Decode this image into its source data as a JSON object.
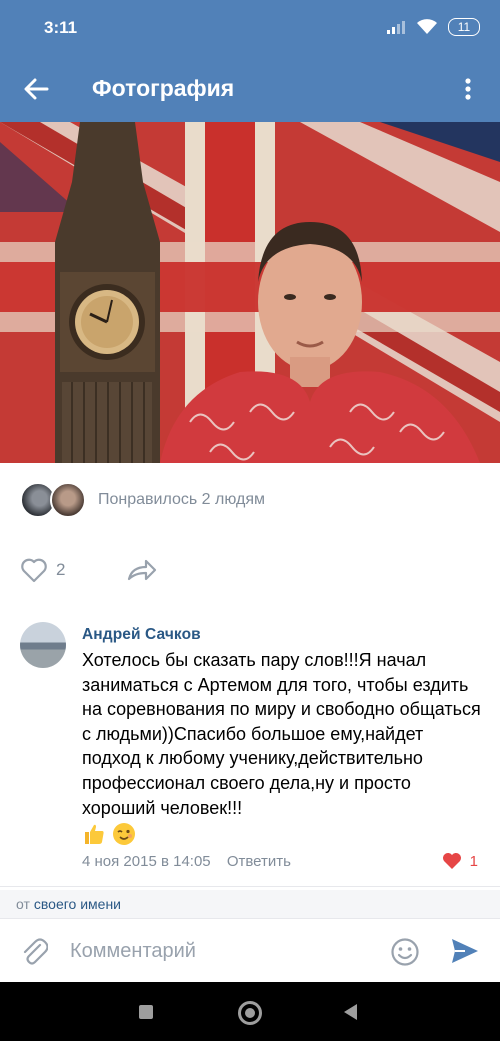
{
  "status_bar": {
    "time": "3:11",
    "battery": "11"
  },
  "appbar": {
    "title": "Фотография"
  },
  "likes": {
    "text": "Понравилось 2 людям",
    "count": "2"
  },
  "comment": {
    "author": "Андрей Сачков",
    "text": "Хотелось бы сказать пару слов!!!Я начал заниматься с Артемом для того, чтобы ездить на соревнования по миру и свободно общаться с людьми))Спасибо большое ему,найдет подход к любому ученику,действительно профессионал своего дела,ну и просто хороший человек!!!",
    "date": "4 ноя 2015 в 14:05",
    "reply_label": "Ответить",
    "like_count": "1"
  },
  "from": {
    "prefix": "от",
    "name": "своего имени"
  },
  "input": {
    "placeholder": "Комментарий"
  },
  "colors": {
    "header": "#5181b8",
    "link": "#2a5885",
    "secondary": "#818c99",
    "like": "#e64646"
  }
}
